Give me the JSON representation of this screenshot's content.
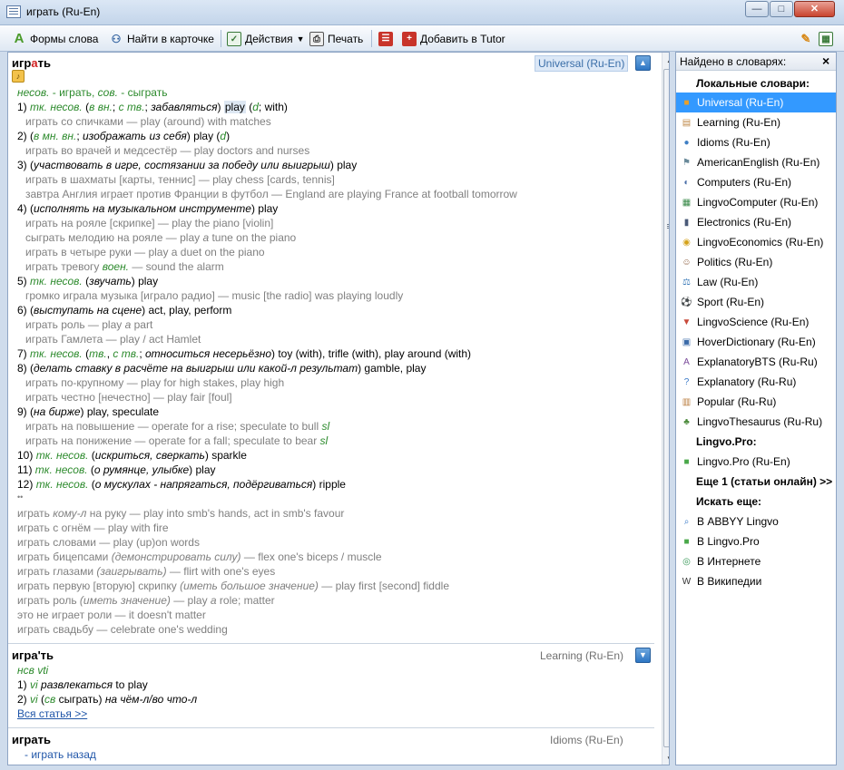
{
  "window": {
    "title": "играть (Ru-En)"
  },
  "toolbar": {
    "word_forms": "Формы слова",
    "find_in_card": "Найти в карточке",
    "actions": "Действия",
    "print": "Печать",
    "add_to_tutor": "Добавить в Tutor"
  },
  "articles": [
    {
      "headword_pre": "игр",
      "headword_accent": "а",
      "headword_post": "ть",
      "dict": "Universal (Ru-En)"
    },
    {
      "headword": "игра'ть",
      "dict": "Learning (Ru-En)"
    },
    {
      "headword": "играть",
      "dict": "Idioms (Ru-En)"
    }
  ],
  "a1": {
    "l0": {
      "g1": "несов.",
      "t1": " - играть, ",
      "g2": "сов.",
      "t2": " - сыграть"
    },
    "l1": {
      "n": "1) ",
      "g1": "тк. несов.",
      "t1": " (",
      "g2": "в",
      "g3": "вн.",
      "t2": "; ",
      "g4": "с",
      "g5": "тв.",
      "t3": "; ",
      "i1": "забавляться",
      "t4": ") ",
      "hl": "play",
      "t5": " (",
      "g6": "d",
      "t6": "; with)"
    },
    "l2": "играть со спичками — play (around) with matches",
    "l3": {
      "n": "2) (",
      "g1": "в",
      "g2": "мн. вн.",
      "t1": "; ",
      "i1": "изображать из себя",
      "t2": ") play (",
      "g3": "d",
      "t3": ")"
    },
    "l4": "играть во врачей и медсестёр — play doctors and nurses",
    "l5": {
      "n": "3) (",
      "i1": "участвовать в игре, состязании за победу или выигрыш",
      "t1": ") play"
    },
    "l6": "играть в шахматы [карты, теннис] — play chess [cards, tennis]",
    "l7": "завтра Англия играет против Франции в футбол — England are playing France at football tomorrow",
    "l8": {
      "n": "4) (",
      "i1": "исполнять на музыкальном инструменте",
      "t1": ") play"
    },
    "l9": "играть на рояле [скрипке] — play the piano [violin]",
    "l10": {
      "t1": "сыграть мелодию на рояле — play ",
      "i1": "a",
      "t2": " tune on the piano"
    },
    "l11": "играть в четыре руки — play a duet on the piano",
    "l12": {
      "t1": "играть тревогу ",
      "g1": "воен.",
      "t2": " — sound the alarm"
    },
    "l13": {
      "n": "5) ",
      "g1": "тк. несов.",
      "t1": " (",
      "i1": "звучать",
      "t2": ") play"
    },
    "l14": "громко играла музыка [играло радио] — music [the radio] was playing loudly",
    "l15": {
      "n": "6) (",
      "i1": "выступать на сцене",
      "t1": ") act, play, perform"
    },
    "l16": {
      "t1": "играть роль — play ",
      "i1": "a",
      "t2": " part"
    },
    "l17": "играть Гамлета — play / act Hamlet",
    "l18": {
      "n": "7) ",
      "g1": "тк. несов.",
      "t1": " (",
      "g2": "тв.",
      "t2": ", ",
      "g3": "с",
      "g4": "тв.",
      "t3": "; ",
      "i1": "относиться несерьёзно",
      "t4": ") toy (with), trifle (with), play around (with)"
    },
    "l19": {
      "n": "8) (",
      "i1": "делать ставку в расчёте на выигрыш или какой-л результат",
      "t1": ") gamble, play"
    },
    "l20": "играть по-крупному — play for high stakes, play high",
    "l21": "играть честно [нечестно] — play fair [foul]",
    "l22": {
      "n": "9) (",
      "i1": "на бирже",
      "t1": ") play, speculate"
    },
    "l23": {
      "t1": "играть на повышение — operate for a rise; speculate to bull ",
      "g1": "sl"
    },
    "l24": {
      "t1": "играть на понижение — operate for a fall; speculate to bear ",
      "g1": "sl"
    },
    "l25": {
      "n": "10) ",
      "g1": "тк. несов.",
      "t1": " (",
      "i1": "искриться, сверкать",
      "t2": ") sparkle"
    },
    "l26": {
      "n": "11) ",
      "g1": "тк. несов.",
      "t1": " (",
      "i1": "о румянце, улыбке",
      "t2": ") play"
    },
    "l27": {
      "n": "12) ",
      "g1": "тк. несов.",
      "t1": " (",
      "i1": "о мускулах - напрягаться, подёргиваться",
      "t2": ") ripple"
    },
    "l28": "••",
    "l29": {
      "t1": "играть ",
      "i1": "кому-л",
      "t2": " на руку — play into smb's hands, act in smb's favour"
    },
    "l30": "играть с огнём — play with fire",
    "l31": "играть словами — play (up)on words",
    "l32": {
      "t1": "играть бицепсами ",
      "i1": "(демонстрировать силу)",
      "t2": " — flex one's biceps / muscle"
    },
    "l33": {
      "t1": "играть глазами ",
      "i1": "(заигрывать)",
      "t2": " — flirt with one's eyes"
    },
    "l34": {
      "t1": "играть первую [вторую] скрипку ",
      "i1": "(иметь большое значение)",
      "t2": " — play first [second] fiddle"
    },
    "l35": {
      "t1": "играть роль ",
      "i1": "(иметь значение)",
      "t2": " — play ",
      "i2": "a",
      "t3": " role; matter"
    },
    "l36": "это не играет роли — it doesn't matter",
    "l37": "играть свадьбу — celebrate one's wedding"
  },
  "a2": {
    "l0": "нсв vti",
    "l1": {
      "n": "1) ",
      "g1": "vi",
      "i1": " развлекаться",
      "t1": " to play"
    },
    "l2": {
      "n": "2) ",
      "g1": "vi",
      "t1": " (",
      "g2": "св",
      "t2": " сыграть",
      "t3": ") ",
      "i1": "на чём-л/во что-л"
    },
    "link": "Вся статья >>"
  },
  "a3": {
    "l0": "- играть назад"
  },
  "panel": {
    "title": "Найдено в словарях:",
    "local_header": "Локальные словари:",
    "local": [
      {
        "label": "Universal (Ru-En)",
        "icon": "book-icon",
        "color": "#e8a02b"
      },
      {
        "label": "Learning (Ru-En)",
        "icon": "notebook-icon",
        "color": "#c08a4a"
      },
      {
        "label": "Idioms (Ru-En)",
        "icon": "speech-icon",
        "color": "#3f7fc4"
      },
      {
        "label": "AmericanEnglish (Ru-En)",
        "icon": "liberty-icon",
        "color": "#6a8a9a"
      },
      {
        "label": "Computers (Ru-En)",
        "icon": "mouse-icon",
        "color": "#4a6ea8"
      },
      {
        "label": "LingvoComputer (Ru-En)",
        "icon": "chip-icon",
        "color": "#3a8a4a"
      },
      {
        "label": "Electronics (Ru-En)",
        "icon": "phone-icon",
        "color": "#4a5a78"
      },
      {
        "label": "LingvoEconomics (Ru-En)",
        "icon": "coin-icon",
        "color": "#d4a21a"
      },
      {
        "label": "Politics (Ru-En)",
        "icon": "person-icon",
        "color": "#8a5a3a"
      },
      {
        "label": "Law (Ru-En)",
        "icon": "scales-icon",
        "color": "#3a7ab8"
      },
      {
        "label": "Sport (Ru-En)",
        "icon": "ball-icon",
        "color": "#333333"
      },
      {
        "label": "LingvoScience (Ru-En)",
        "icon": "shield-icon",
        "color": "#c84a3a"
      },
      {
        "label": "HoverDictionary (Ru-En)",
        "icon": "window-icon",
        "color": "#3a6aa8"
      },
      {
        "label": "ExplanatoryBTS (Ru-Ru)",
        "icon": "alphabet-icon",
        "color": "#7a4a9a"
      },
      {
        "label": "Explanatory (Ru-Ru)",
        "icon": "question-icon",
        "color": "#3a7ac8"
      },
      {
        "label": "Popular (Ru-Ru)",
        "icon": "open-book-icon",
        "color": "#b87a3a"
      },
      {
        "label": "LingvoThesaurus (Ru-Ru)",
        "icon": "tree-icon",
        "color": "#4a8a3a"
      }
    ],
    "pro_header": "Lingvo.Pro:",
    "pro": [
      {
        "label": "Lingvo.Pro (Ru-En)",
        "icon": "pro-icon",
        "color": "#4aa84a"
      }
    ],
    "more": "Еще 1 (статьи онлайн) >>",
    "search_header": "Искать еще:",
    "search": [
      {
        "label": "В ABBYY Lingvo",
        "icon": "magnifier-icon",
        "color": "#3a7ac8"
      },
      {
        "label": "В Lingvo.Pro",
        "icon": "pro-icon",
        "color": "#4aa84a"
      },
      {
        "label": "В Интернете",
        "icon": "globe-icon",
        "color": "#3a9a5a"
      },
      {
        "label": "В Википедии",
        "icon": "wikipedia-icon",
        "color": "#333333"
      }
    ]
  }
}
